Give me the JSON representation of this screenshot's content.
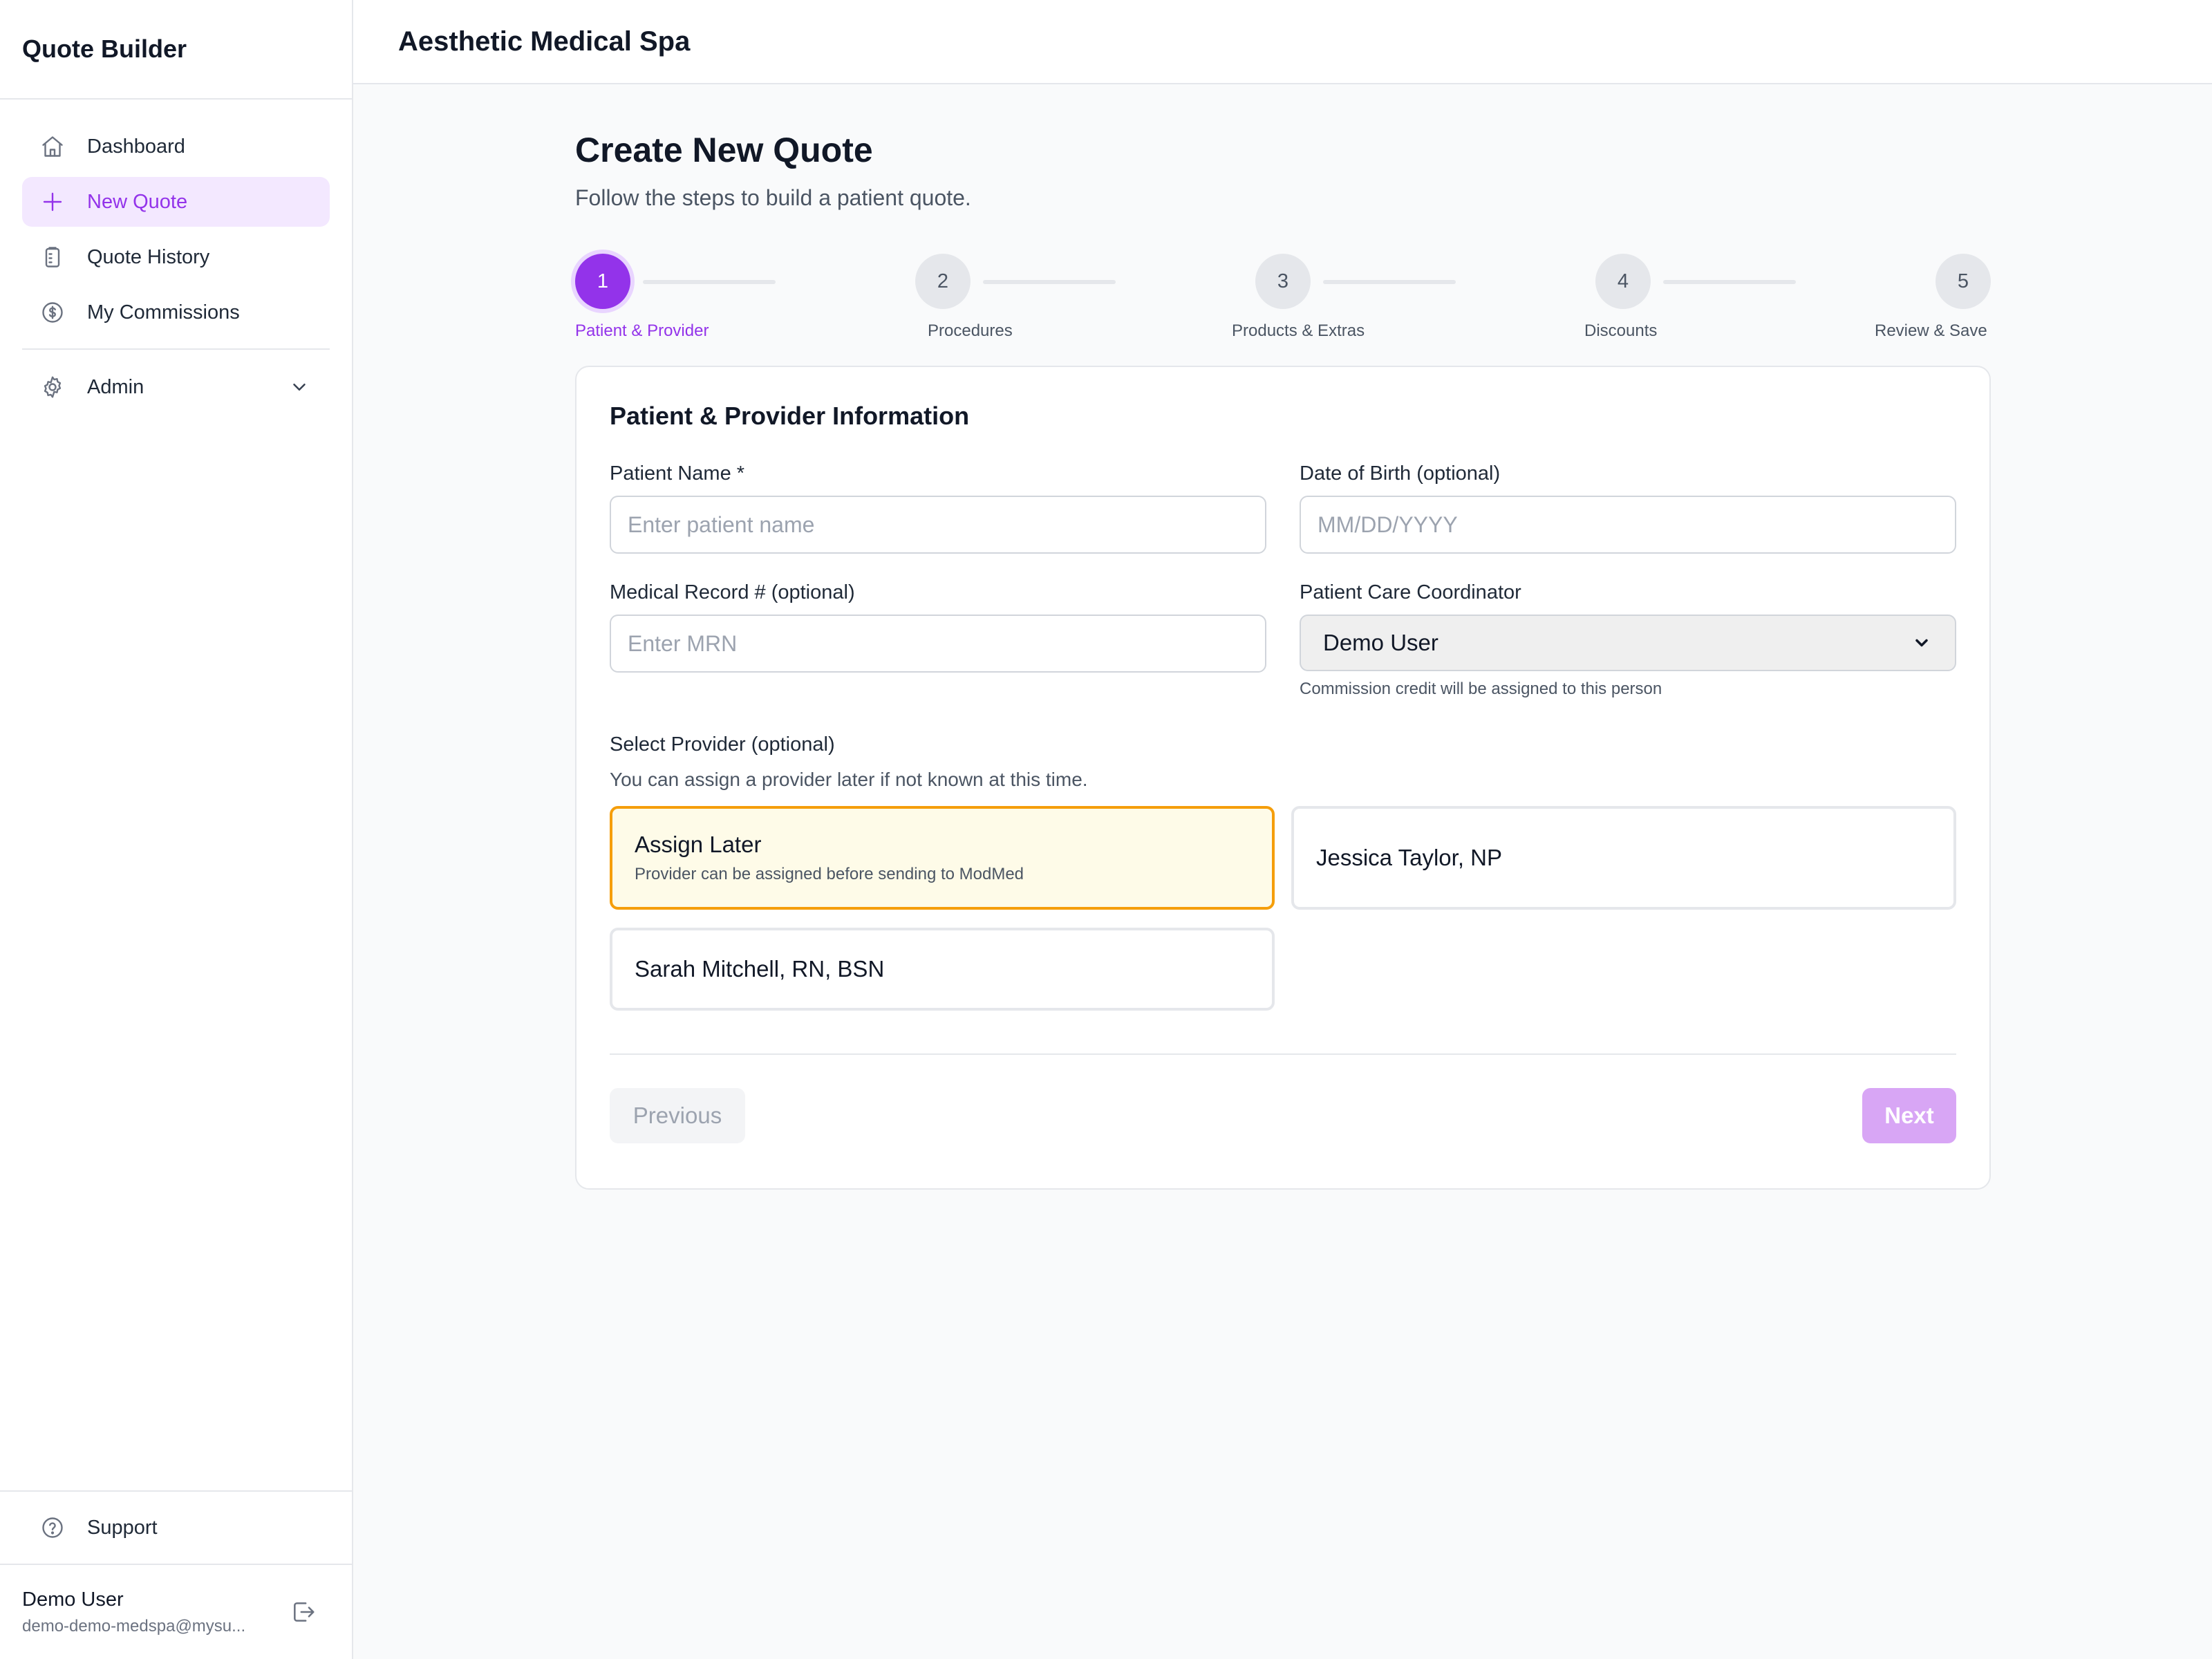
{
  "sidebar": {
    "brand": "Quote Builder",
    "items": [
      {
        "label": "Dashboard",
        "icon": "home-icon"
      },
      {
        "label": "New Quote",
        "icon": "plus-icon",
        "active": true
      },
      {
        "label": "Quote History",
        "icon": "clipboard-icon"
      },
      {
        "label": "My Commissions",
        "icon": "dollar-circle-icon"
      }
    ],
    "admin": {
      "label": "Admin",
      "icon": "gear-icon"
    },
    "support": {
      "label": "Support",
      "icon": "help-circle-icon"
    },
    "user": {
      "name": "Demo User",
      "email": "demo-demo-medspa@mysu..."
    }
  },
  "header": {
    "title": "Aesthetic Medical Spa"
  },
  "page": {
    "title": "Create New Quote",
    "subtitle": "Follow the steps to build a patient quote."
  },
  "steps": [
    {
      "number": "1",
      "label": "Patient & Provider",
      "active": true
    },
    {
      "number": "2",
      "label": "Procedures"
    },
    {
      "number": "3",
      "label": "Products & Extras"
    },
    {
      "number": "4",
      "label": "Discounts"
    },
    {
      "number": "5",
      "label": "Review & Save"
    }
  ],
  "form": {
    "title": "Patient & Provider Information",
    "patient_name": {
      "label": "Patient Name *",
      "placeholder": "Enter patient name",
      "value": ""
    },
    "dob": {
      "label": "Date of Birth (optional)",
      "placeholder": "MM/DD/YYYY",
      "value": ""
    },
    "mrn": {
      "label": "Medical Record # (optional)",
      "placeholder": "Enter MRN",
      "value": ""
    },
    "coordinator": {
      "label": "Patient Care Coordinator",
      "value": "Demo User",
      "help": "Commission credit will be assigned to this person"
    },
    "provider": {
      "label": "Select Provider (optional)",
      "sublabel": "You can assign a provider later if not known at this time.",
      "options": [
        {
          "name": "Assign Later",
          "desc": "Provider can be assigned before sending to ModMed",
          "selected": true
        },
        {
          "name": "Jessica Taylor, NP"
        },
        {
          "name": "Sarah Mitchell, RN, BSN"
        }
      ]
    },
    "prev_label": "Previous",
    "next_label": "Next"
  },
  "colors": {
    "accent": "#9333ea",
    "accent_light": "#f3e8ff",
    "selected_border": "#f59e0b",
    "selected_bg": "#fefbe8",
    "next_disabled": "#d8a6f5"
  }
}
